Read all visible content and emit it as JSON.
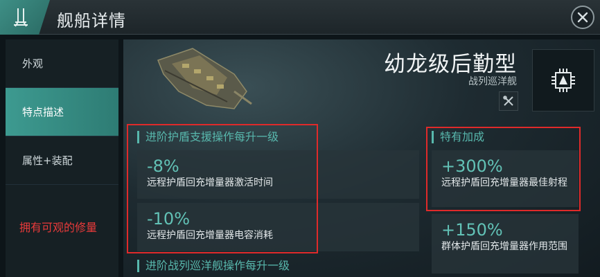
{
  "header": {
    "title": "舰船详情"
  },
  "sidebar": {
    "items": [
      {
        "label": "外观"
      },
      {
        "label": "特点描述"
      },
      {
        "label": "属性+装配"
      }
    ],
    "annotation": "拥有可观的修量"
  },
  "ship": {
    "name": "幼龙级后勤型",
    "class": "战列巡洋舰"
  },
  "skill_bonus": {
    "heading": "进阶护盾支援操作每升一级",
    "cards": [
      {
        "value": "-8%",
        "description": "远程护盾回充增量器激活时间"
      },
      {
        "value": "-10%",
        "description": "远程护盾回充增量器电容消耗"
      }
    ],
    "heading2": "进阶战列巡洋舰操作每升一级"
  },
  "role_bonus": {
    "heading": "特有加成",
    "cards": [
      {
        "value": "+300%",
        "description": "远程护盾回充增量器最佳射程"
      },
      {
        "value": "+150%",
        "description": "群体护盾回充增量器作用范围"
      }
    ]
  },
  "colors": {
    "accent": "#58b8ad",
    "active_tab": "#3d9a90",
    "highlight": "#e02a2a",
    "annotation": "#e83a3a"
  }
}
